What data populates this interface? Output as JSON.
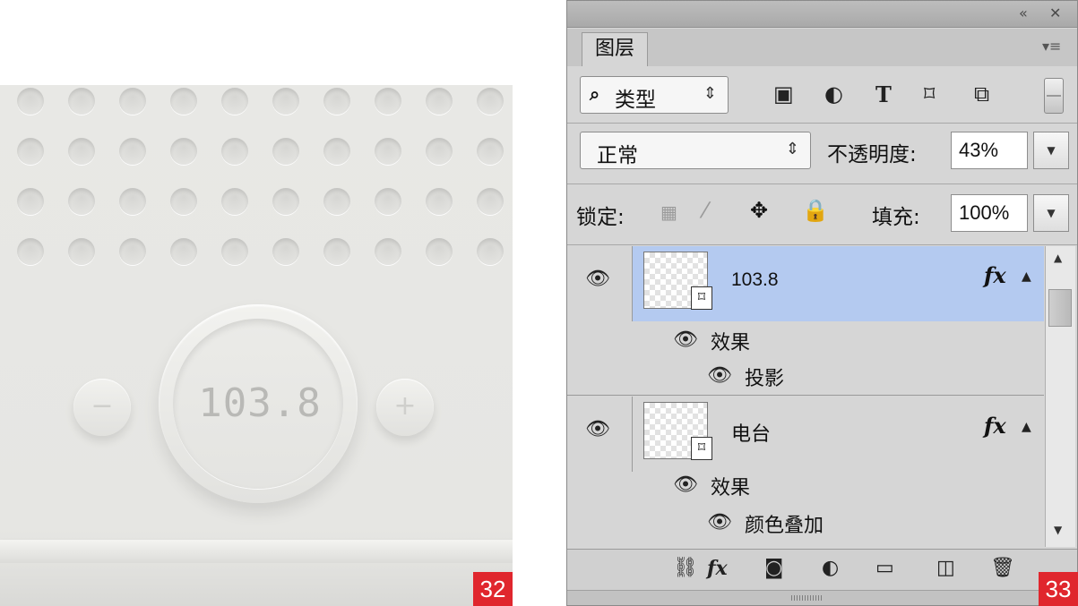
{
  "radio_mockup": {
    "frequency_display": "103.8",
    "minus_label": "−",
    "plus_label": "+",
    "page_number": "32"
  },
  "layers_panel": {
    "title_bar": {
      "collapse_icon": "double-chevron-left",
      "close_icon": "close-x"
    },
    "tab_label": "图层",
    "panel_menu_icon": "panel-menu",
    "filter": {
      "kind_label": "类型",
      "icons": [
        "pixel-layer-filter-icon",
        "adjustment-layer-filter-icon",
        "type-layer-filter-icon",
        "shape-layer-filter-icon",
        "smart-object-filter-icon"
      ]
    },
    "blend_mode": "正常",
    "opacity_label": "不透明度:",
    "opacity_value": "43%",
    "lock_label": "锁定:",
    "fill_label": "填充:",
    "fill_value": "100%",
    "layers": [
      {
        "name": "103.8",
        "selected": true,
        "has_fx": true,
        "effects_label": "效果",
        "effects": [
          "投影"
        ]
      },
      {
        "name": "电台",
        "selected": false,
        "has_fx": true,
        "effects_label": "效果",
        "effects": [
          "颜色叠加"
        ]
      }
    ],
    "bottom_icons": [
      "link-layers-icon",
      "add-style-icon",
      "add-mask-icon",
      "new-adjustment-icon",
      "new-group-icon",
      "new-layer-icon",
      "delete-layer-icon"
    ],
    "page_number": "33"
  },
  "colors": {
    "selection": "#b4caf0",
    "panel_bg": "#d6d6d6",
    "page_badge": "#e0262d"
  }
}
